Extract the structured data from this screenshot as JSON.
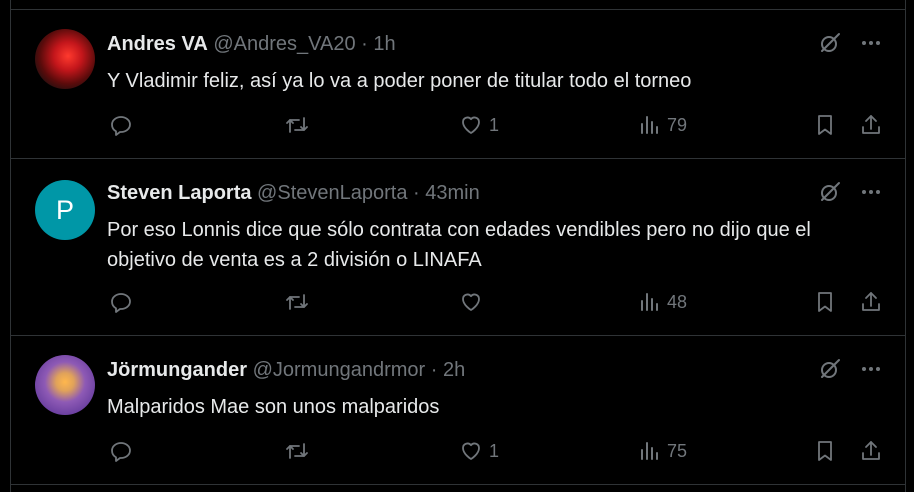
{
  "tweets": [
    {
      "name": "Andres VA",
      "handle": "@Andres_VA20",
      "separator": " · ",
      "time": "1h",
      "text": "Y Vladimir feliz, así ya lo va a poder poner de titular todo el torneo",
      "likes": "1",
      "views": "79"
    },
    {
      "name": "Steven Laporta",
      "avatar_letter": "P",
      "handle": "@StevenLaporta",
      "separator": " · ",
      "time": "43min",
      "text": "Por eso Lonnis dice que sólo contrata con edades vendibles pero no dijo que el objetivo de venta es a 2 división o LINAFA",
      "likes": "",
      "views": "48"
    },
    {
      "name": "Jörmungander",
      "handle": "@Jormungandrmor",
      "separator": " · ",
      "time": "2h",
      "text": "Malparidos Mae son unos malparidos",
      "likes": "1",
      "views": "75"
    }
  ],
  "icons": [
    "avatar",
    "grok-icon",
    "more-icon",
    "reply-icon",
    "retweet-icon",
    "heart-icon",
    "views-icon",
    "bookmark-icon",
    "share-icon"
  ],
  "colors": {
    "background": "#000000",
    "text": "#e7e9ea",
    "muted": "#71767b",
    "border": "#2f3336",
    "avatar_p": "#0097a7"
  }
}
